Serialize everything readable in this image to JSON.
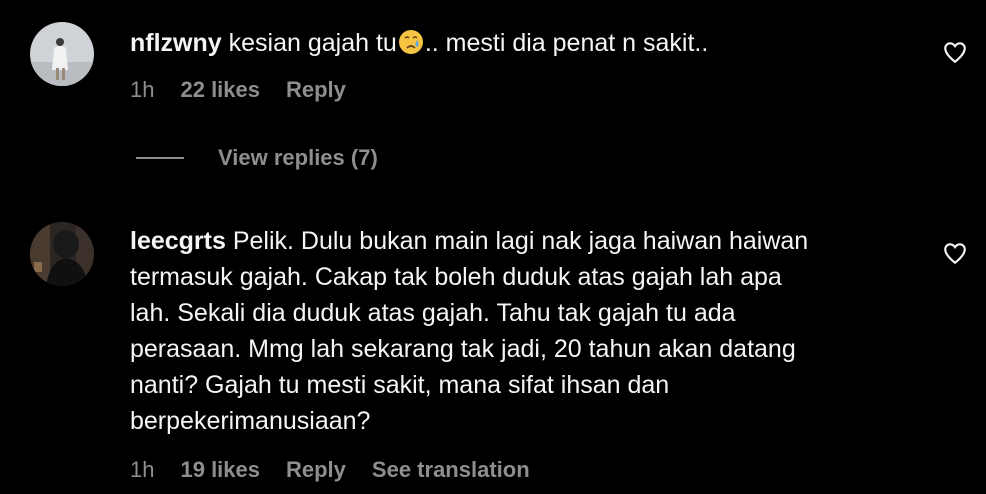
{
  "comments": [
    {
      "username": "nflzwny",
      "text_before_emoji": "kesian gajah tu",
      "emoji": "crying-face",
      "text_after_emoji": ".. mesti dia penat n sakit..",
      "time": "1h",
      "likes": "22 likes",
      "reply_label": "Reply",
      "heart_icon": "heart-outline-icon"
    },
    {
      "username": "leecgrts",
      "text": "Pelik. Dulu bukan main lagi nak jaga haiwan haiwan\ntermasuk gajah. Cakap tak boleh duduk atas gajah lah apa\nlah. Sekali dia duduk atas gajah. Tahu tak gajah tu ada\nperasaan. Mmg lah sekarang tak jadi, 20 tahun akan datang\nnanti? Gajah tu mesti sakit, mana sifat ihsan dan\nberpekerimanusiaan?",
      "time": "1h",
      "likes": "19 likes",
      "reply_label": "Reply",
      "translate_label": "See translation",
      "heart_icon": "heart-outline-icon"
    }
  ],
  "view_replies": {
    "label": "View replies (7)"
  },
  "colors": {
    "background": "#000000",
    "text": "#f5f5f5",
    "muted": "#8e8e8e"
  }
}
